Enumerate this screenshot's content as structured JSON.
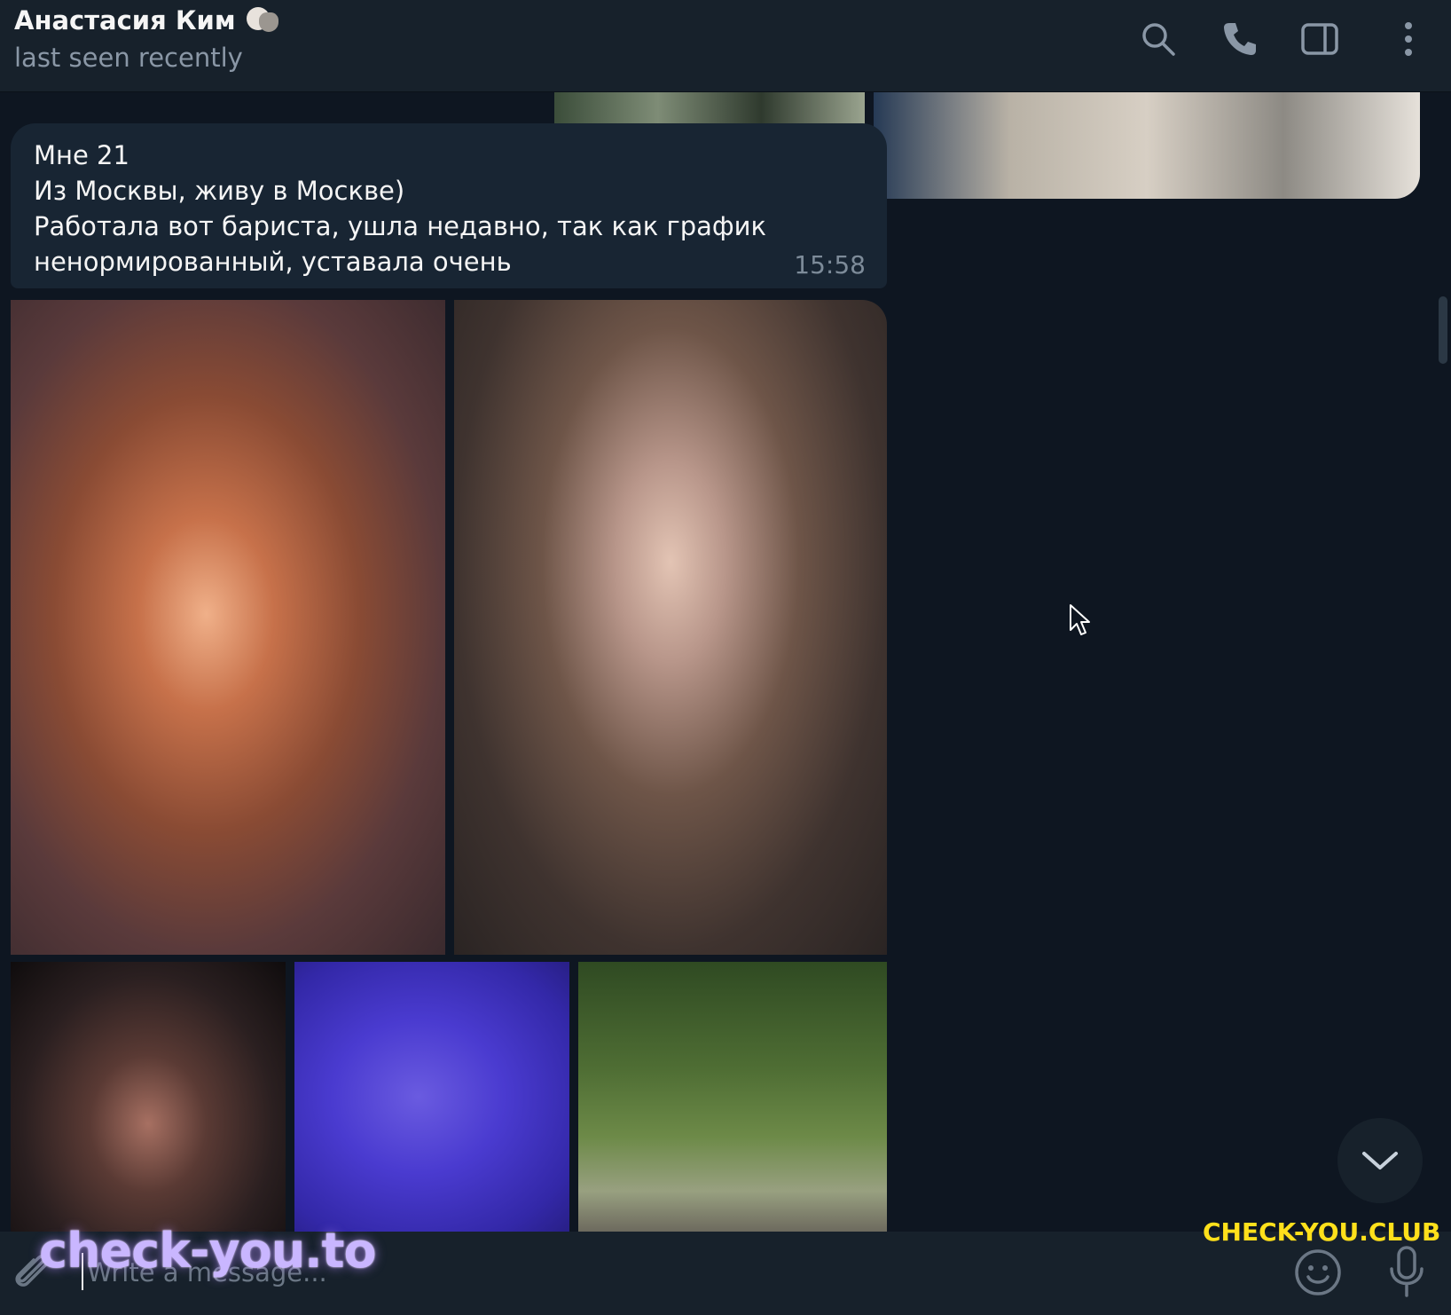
{
  "header": {
    "contact_name": "Анастасия Ким",
    "status": "last seen recently",
    "icons": [
      "search-icon",
      "phone-icon",
      "sidebar-toggle-icon",
      "more-vertical-icon"
    ]
  },
  "message": {
    "lines": [
      "Мне 21",
      "Из Москвы, живу в Москве)",
      "Работала вот бариста, ушла недавно, так как график",
      "ненормированный, уставала очень"
    ],
    "time": "15:58"
  },
  "composer": {
    "placeholder": "Write a message...",
    "icons": [
      "attach-icon",
      "emoji-icon",
      "microphone-icon"
    ]
  },
  "watermarks": {
    "left": "check-you.to",
    "right": "CHECK-YOU.CLUB"
  },
  "colors": {
    "background": "#0e1621",
    "header": "#17212b",
    "bubble": "#182533",
    "secondary_text": "#8a97a6",
    "watermark_right": "#ffe01b"
  }
}
